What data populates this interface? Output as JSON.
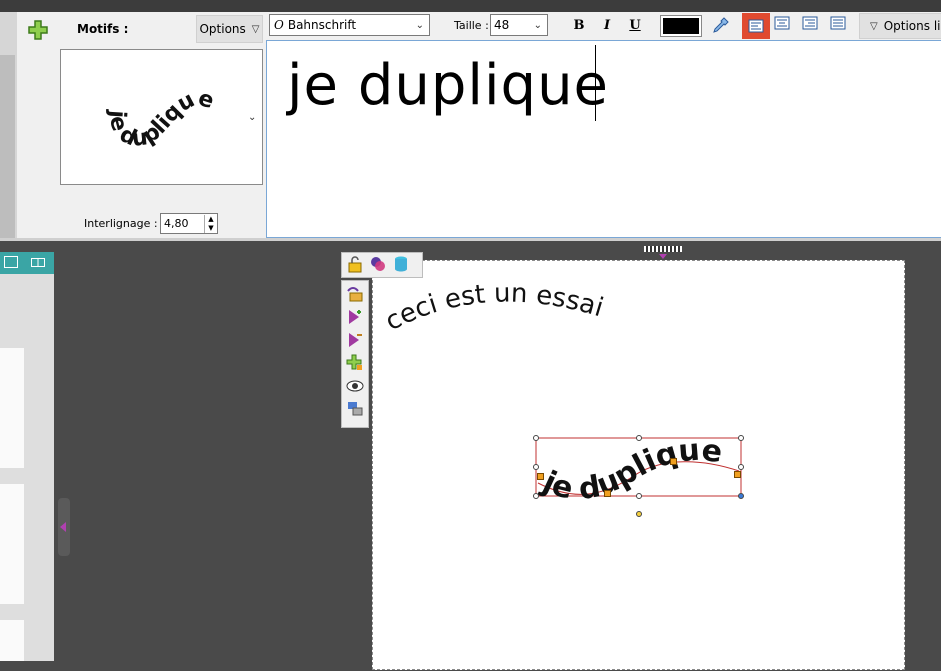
{
  "ribbon": {
    "motifs_label": "Motifs :",
    "options_button": "Options",
    "font_name": "Bahnschrift",
    "taille_label": "Taille :",
    "taille_value": "48",
    "bold": "B",
    "italic": "I",
    "underline": "U",
    "text_color": "#000000",
    "options_right": "Options lig",
    "interlignage_label": "Interlignage :",
    "interlignage_value": "4,80",
    "preview_text": "je duplique"
  },
  "editor": {
    "text": "je duplique"
  },
  "canvas": {
    "arc_text": "ceci est un essai",
    "wave_text": "je duplique"
  },
  "colors": {
    "accent_red": "#e04a2f",
    "selection_border": "#c03030",
    "handle_orange": "#f0a020",
    "tab_teal": "#3aa5a5"
  }
}
